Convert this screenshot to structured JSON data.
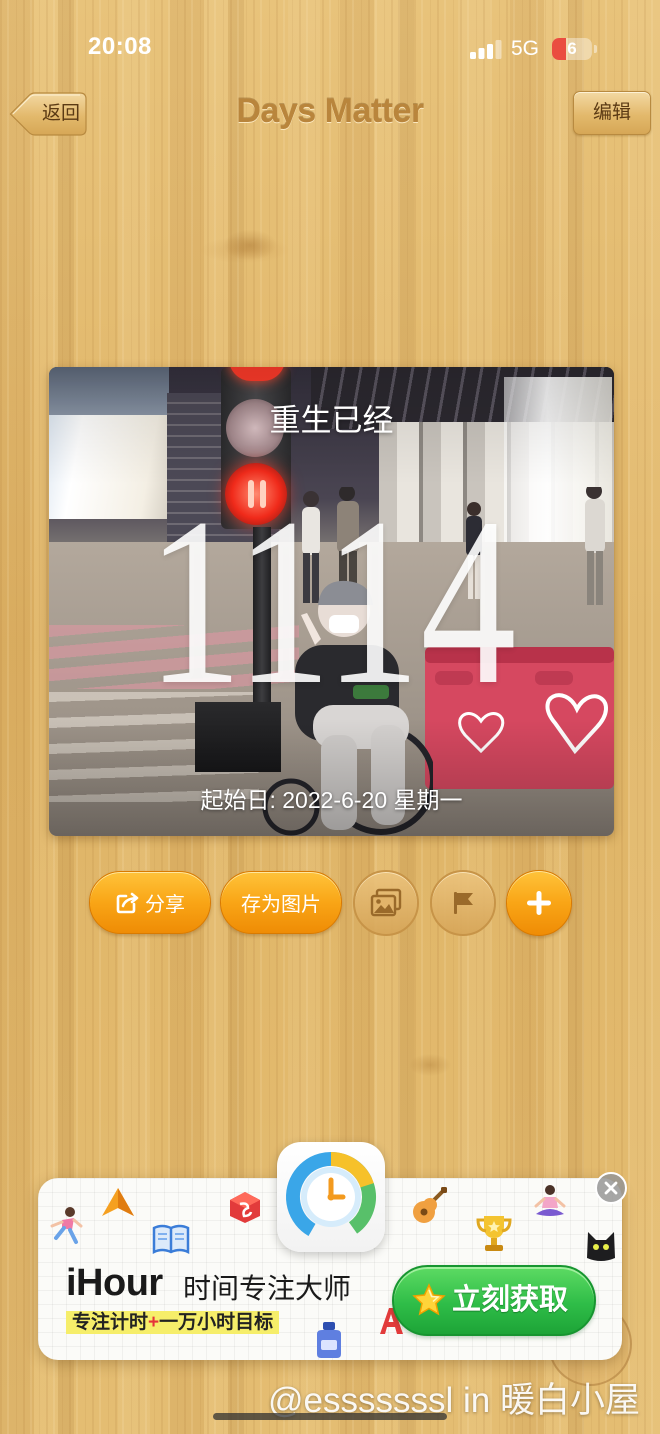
{
  "status_bar": {
    "time": "20:08",
    "network": "5G",
    "battery": "6"
  },
  "header": {
    "back_label": "返回",
    "title": "Days Matter",
    "edit_label": "编辑"
  },
  "card": {
    "title": "重生已经",
    "days": "1114",
    "start_label": "起始日: 2022-6-20 星期一"
  },
  "actions": {
    "share_label": "分享",
    "save_image_label": "存为图片"
  },
  "ad": {
    "brand": "iHour",
    "tagline": "时间专注大师",
    "highlight_left": "专注计时",
    "highlight_plus": "+",
    "highlight_right": "一万小时目标",
    "cta_label": "立刻获取"
  },
  "watermark": "@esssssssl in 暖白小屋",
  "icons": {
    "back": "back-arrow-icon",
    "share": "share-icon",
    "gallery": "image-gallery-icon",
    "flag": "flag-icon",
    "add": "plus-icon",
    "close": "close-icon",
    "app": "clock-app-icon",
    "cta": "star-icon"
  },
  "colors": {
    "wood": "#e2bb70",
    "title_brown": "#b9853c",
    "accent_orange": "#f9a516",
    "cta_green": "#2fbd48",
    "battery_low": "#ea4d40"
  }
}
